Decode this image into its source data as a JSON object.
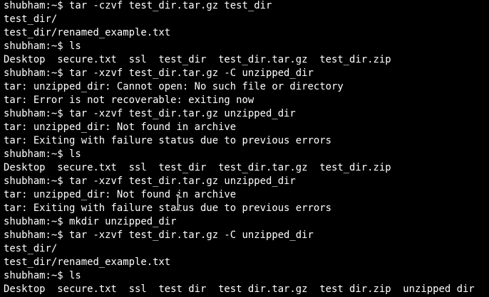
{
  "terminal": {
    "lines": [
      "shubham:~$ tar -czvf test_dir.tar.gz test_dir",
      "test_dir/",
      "test_dir/renamed_example.txt",
      "shubham:~$ ls",
      "Desktop  secure.txt  ssl  test_dir  test_dir.tar.gz  test_dir.zip",
      "shubham:~$ tar -xzvf test_dir.tar.gz -C unzipped_dir",
      "tar: unzipped_dir: Cannot open: No such file or directory",
      "tar: Error is not recoverable: exiting now",
      "shubham:~$ tar -xzvf test_dir.tar.gz unzipped_dir",
      "tar: unzipped_dir: Not found in archive",
      "tar: Exiting with failure status due to previous errors",
      "shubham:~$ ls",
      "Desktop  secure.txt  ssl  test_dir  test_dir.tar.gz  test_dir.zip",
      "shubham:~$ tar -xzvf test_dir.tar.gz unzipped_dir",
      "tar: unzipped_dir: Not found in archive",
      "tar: Exiting with failure status due to previous errors",
      "shubham:~$ mkdir unzipped_dir",
      "shubham:~$ tar -xzvf test_dir.tar.gz -C unzipped_dir",
      "test_dir/",
      "test_dir/renamed_example.txt",
      "shubham:~$ ls",
      "Desktop  secure.txt  ssl  test_dir  test_dir.tar.gz  test_dir.zip  unzipped_dir"
    ],
    "colors": {
      "background": "#000000",
      "foreground": "#ffffff"
    },
    "mouse_cursor_icon": "text-cursor-icon"
  }
}
